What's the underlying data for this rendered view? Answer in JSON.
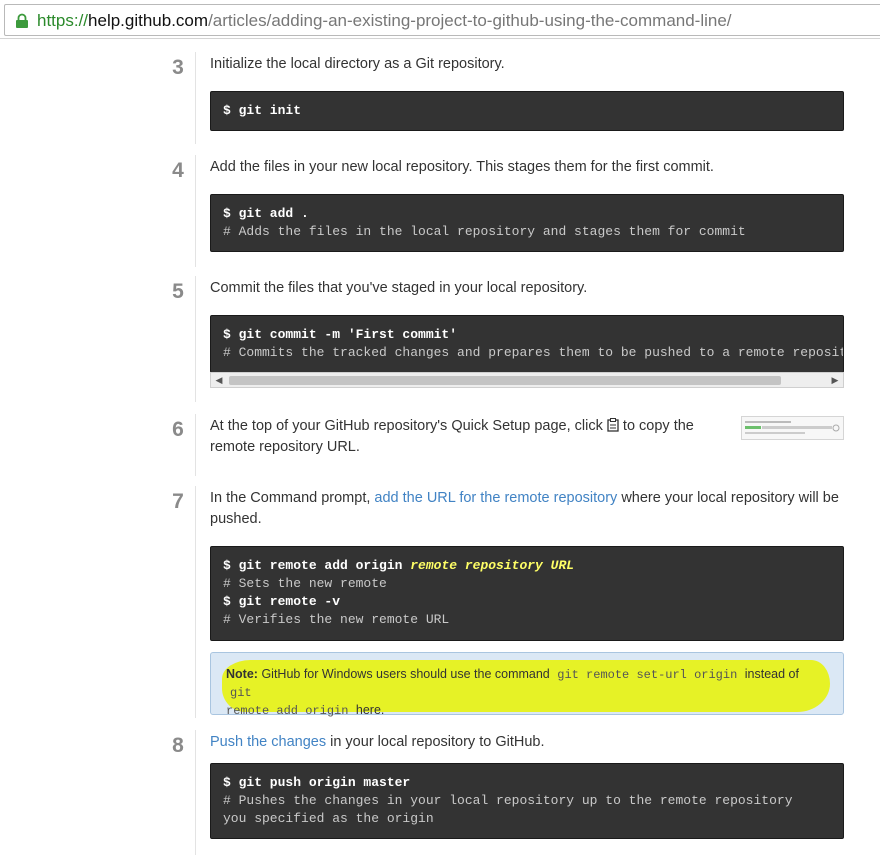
{
  "browser": {
    "url_proto": "https://",
    "url_host": "help.github.com",
    "url_path": "/articles/adding-an-existing-project-to-github-using-the-command-line/"
  },
  "steps": [
    {
      "number": "3",
      "text": "Initialize the local directory as a Git repository.",
      "code": [
        {
          "kind": "cmd",
          "text": "$ git init"
        }
      ]
    },
    {
      "number": "4",
      "text": "Add the files in your new local repository. This stages them for the first commit.",
      "code": [
        {
          "kind": "cmd",
          "text": "$ git add ."
        },
        {
          "kind": "cmt",
          "text": "# Adds the files in the local repository and stages them for commit"
        }
      ]
    },
    {
      "number": "5",
      "text": "Commit the files that you've staged in your local repository.",
      "code": [
        {
          "kind": "cmd",
          "text": "$ git commit -m 'First commit'"
        },
        {
          "kind": "cmt",
          "text": "# Commits the tracked changes and prepares them to be pushed to a remote repository"
        }
      ]
    },
    {
      "number": "6",
      "text_before": "At the top of your GitHub repository's Quick Setup page, click",
      "text_after": "to copy the",
      "text_line2": "remote repository URL."
    },
    {
      "number": "7",
      "text_before": "In the Command prompt, ",
      "link": "add the URL for the remote repository",
      "text_after": " where your local repository will be",
      "text_line2": "pushed.",
      "code": [
        {
          "kind": "cmd",
          "text": "$ git remote add origin ",
          "placeholder": "remote repository URL"
        },
        {
          "kind": "cmt",
          "text": "# Sets the new remote"
        },
        {
          "kind": "cmd",
          "text": "$ git remote -v"
        },
        {
          "kind": "cmt",
          "text": "# Verifies the new remote URL"
        }
      ],
      "note": {
        "label": "Note:",
        "text1": "GitHub for Windows users should use the command",
        "code1": "git remote set-url origin",
        "text2": "instead of",
        "code2a": "git",
        "code2b": "remote add origin",
        "text3": "here."
      }
    },
    {
      "number": "8",
      "link": "Push the changes",
      "text_after": " in your local repository to GitHub.",
      "code": [
        {
          "kind": "cmd",
          "text": "$ git push origin master"
        },
        {
          "kind": "cmt",
          "text": "# Pushes the changes in your local repository up to the remote repository"
        },
        {
          "kind": "cmt",
          "text": "you specified as the origin"
        }
      ]
    }
  ],
  "colors": {
    "code_bg": "#333333",
    "link": "#4183c4",
    "highlight": "#e7f214",
    "note_bg": "#dbe8f5"
  }
}
